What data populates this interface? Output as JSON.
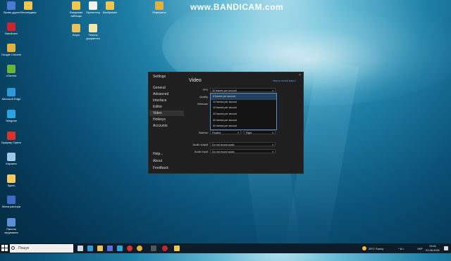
{
  "watermark": "www.BANDICAM.com",
  "desktop_icons": [
    {
      "label": "Прово друга",
      "color": "#4a7bd8"
    },
    {
      "label": "Bandicam",
      "color": "#c8262e"
    },
    {
      "label": "Google Chrome",
      "color": "#e0b23c"
    },
    {
      "label": "uTorrent",
      "color": "#69b33b"
    },
    {
      "label": "Microsoft Edge",
      "color": "#2a9bd8"
    },
    {
      "label": "Telegram",
      "color": "#2aa4e0"
    },
    {
      "label": "Браузер Opera",
      "color": "#d7322e"
    },
    {
      "label": "Корзина",
      "color": "#9fc7e6"
    },
    {
      "label": "Здать",
      "color": "#f3cd63"
    },
    {
      "label": "Мини растора",
      "color": "#3e6ac4"
    },
    {
      "label": "Панель керування",
      "color": "#5d8fd6"
    },
    {
      "label": "Мессенджер",
      "color": "#f0c64d"
    },
    {
      "label": "Бюро",
      "color": "#e8c259"
    },
    {
      "label": "Ежедневн таблицы",
      "color": "#f0c64d"
    },
    {
      "label": "Презентац",
      "color": "#f3f3f3"
    },
    {
      "label": "Изображен",
      "color": "#f0c64d"
    },
    {
      "label": "Тексты документа",
      "color": "#f5e7a8"
    },
    {
      "label": "Рефераты",
      "color": "#e0b23c"
    }
  ],
  "dialog": {
    "title": "Settings",
    "close": "×",
    "nav": [
      "General",
      "Advanced",
      "Interface",
      "Editor",
      "Video",
      "Hotkeys",
      "Accounts"
    ],
    "nav_bottom": [
      "Help...",
      "About",
      "Feedback"
    ],
    "active_nav": "Video",
    "content_title": "Video",
    "howto_link": "How to record video?",
    "fields": {
      "fps_label": "FPS",
      "fps_value": "30 frames per second",
      "quality_label": "Quality",
      "webcam_label": "Webcam",
      "sidebar_label": "Sidebar",
      "sidebar_value": "Floated",
      "sidebar_side": "Right",
      "audio_output_label": "Audio output",
      "audio_output_value": "Do not record audio",
      "audio_input_label": "Audio input",
      "audio_input_value": "Do not record audio"
    },
    "fps_options": [
      "5 frames per second",
      "10 frames per second",
      "15 frames per second",
      "20 frames per second",
      "30 frames per second",
      "60 frames per second"
    ],
    "fps_highlighted": "5 frames per second"
  },
  "taskbar": {
    "search_placeholder": "Пошук",
    "weather": "25°C Sunny",
    "lang": "УКР",
    "time": "13:41",
    "date": "21.06.2021"
  }
}
